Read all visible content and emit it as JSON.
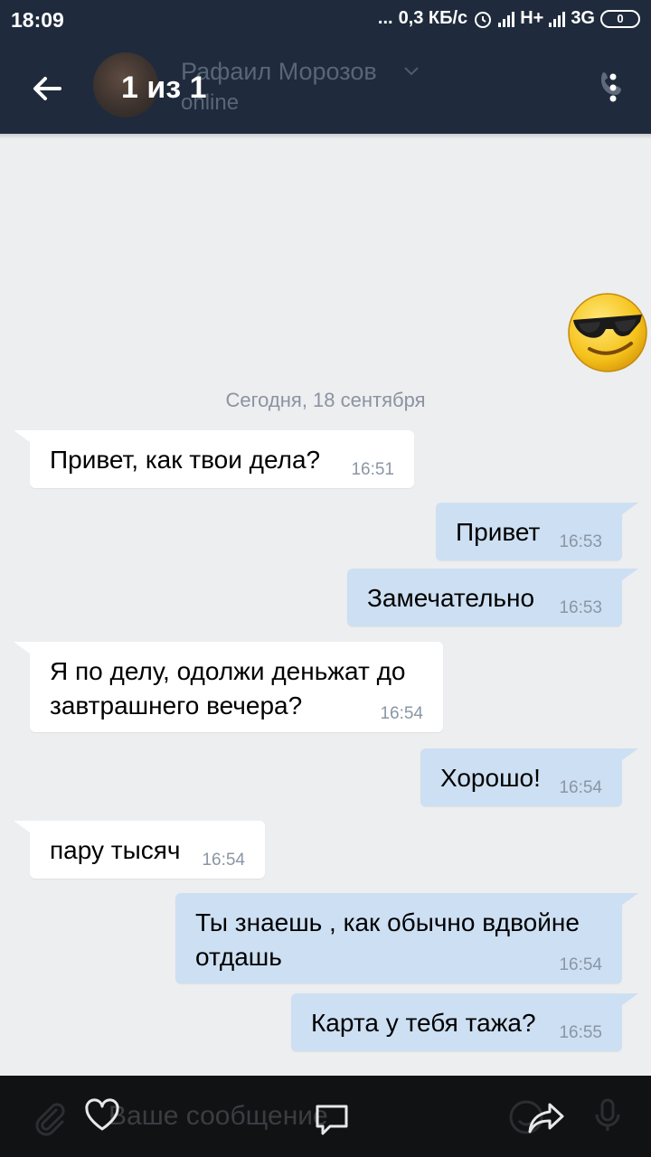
{
  "status_bar": {
    "time": "18:09",
    "dots": "...",
    "speed": "0,3 КБ/с",
    "network1": "H+",
    "network2": "3G",
    "battery": "0"
  },
  "header": {
    "contact_name": "Рафаил Морозов",
    "contact_status": "online",
    "counter": "1 из 1",
    "icons": {
      "back": "back-arrow-icon",
      "call": "phone-icon",
      "menu": "more-vert-icon"
    }
  },
  "chat": {
    "date_separator": "Сегодня, 18 сентября",
    "messages": [
      {
        "dir": "in",
        "text": "Привет, как твои дела?",
        "time": "16:51"
      },
      {
        "dir": "out",
        "text": "Привет",
        "time": "16:53"
      },
      {
        "dir": "out",
        "text": "Замечательно",
        "time": "16:53"
      },
      {
        "dir": "in",
        "line1": "Я по делу, одолжи деньжат до",
        "line2": "завтрашнего вечера?",
        "time": "16:54"
      },
      {
        "dir": "out",
        "text": "Хорошо!",
        "time": "16:54"
      },
      {
        "dir": "in",
        "text": "пару тысяч",
        "time": "16:54"
      },
      {
        "dir": "out",
        "line1": "Ты знаешь , как обычно вдвойне",
        "line2": "отдашь",
        "time": "16:54"
      },
      {
        "dir": "out",
        "text": "Карта у тебя тажа?",
        "time": "16:55"
      }
    ]
  },
  "composer": {
    "placeholder": "Ваше сообщение",
    "icons": [
      "attach-icon",
      "heart-icon",
      "comment-icon",
      "emoji-icon",
      "share-icon",
      "mic-icon"
    ]
  },
  "colors": {
    "header_bg": "#1f2b3c",
    "chat_bg": "#edeef0",
    "incoming_bubble": "#ffffff",
    "outgoing_bubble": "#cddff2",
    "bottom_bar": "#111214"
  }
}
